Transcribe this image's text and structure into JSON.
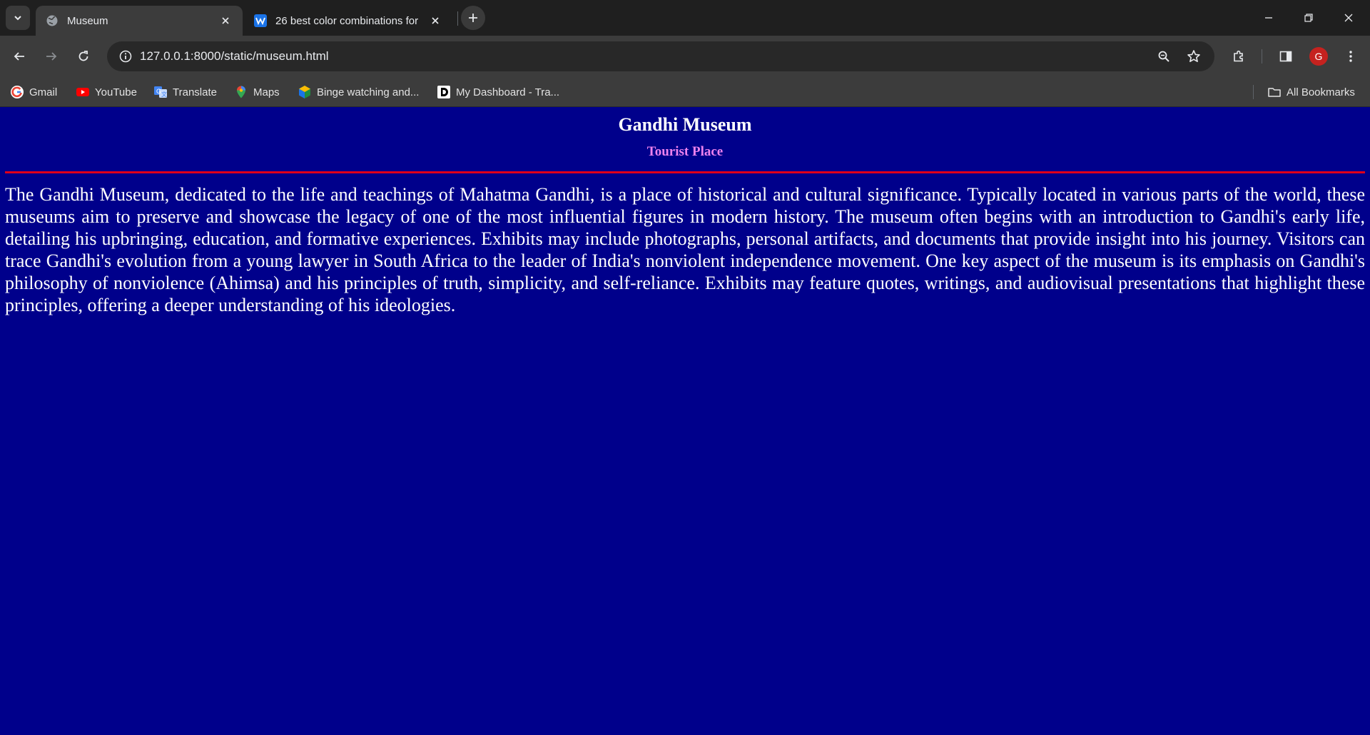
{
  "browser": {
    "tabs": [
      {
        "title": "Museum",
        "favicon": "globe-icon",
        "active": true
      },
      {
        "title": "26 best color combinations for",
        "favicon": "w-app-icon",
        "active": false
      }
    ],
    "url": "127.0.0.1:8000/static/museum.html",
    "profile_initial": "G",
    "bookmarks": [
      {
        "label": "Gmail",
        "icon": "google-icon"
      },
      {
        "label": "YouTube",
        "icon": "youtube-icon"
      },
      {
        "label": "Translate",
        "icon": "translate-icon"
      },
      {
        "label": "Maps",
        "icon": "maps-icon"
      },
      {
        "label": "Binge watching and...",
        "icon": "binge-icon"
      },
      {
        "label": "My Dashboard - Tra...",
        "icon": "d-icon"
      }
    ],
    "all_bookmarks_label": "All Bookmarks"
  },
  "page": {
    "title": "Gandhi Museum",
    "subtitle": "Tourist Place",
    "body": "The Gandhi Museum, dedicated to the life and teachings of Mahatma Gandhi, is a place of historical and cultural significance. Typically located in various parts of the world, these museums aim to preserve and showcase the legacy of one of the most influential figures in modern history. The museum often begins with an introduction to Gandhi's early life, detailing his upbringing, education, and formative experiences. Exhibits may include photographs, personal artifacts, and documents that provide insight into his journey. Visitors can trace Gandhi's evolution from a young lawyer in South Africa to the leader of India's nonviolent independence movement. One key aspect of the museum is its emphasis on Gandhi's philosophy of nonviolence (Ahimsa) and his principles of truth, simplicity, and self-reliance. Exhibits may feature quotes, writings, and audiovisual presentations that highlight these principles, offering a deeper understanding of his ideologies."
  },
  "colors": {
    "page_background": "#00008b",
    "title": "#ffffff",
    "subtitle": "#ee82ee",
    "rule": "#e0001a",
    "chrome_dark": "#1f1f1f",
    "chrome": "#3c3c3c"
  }
}
